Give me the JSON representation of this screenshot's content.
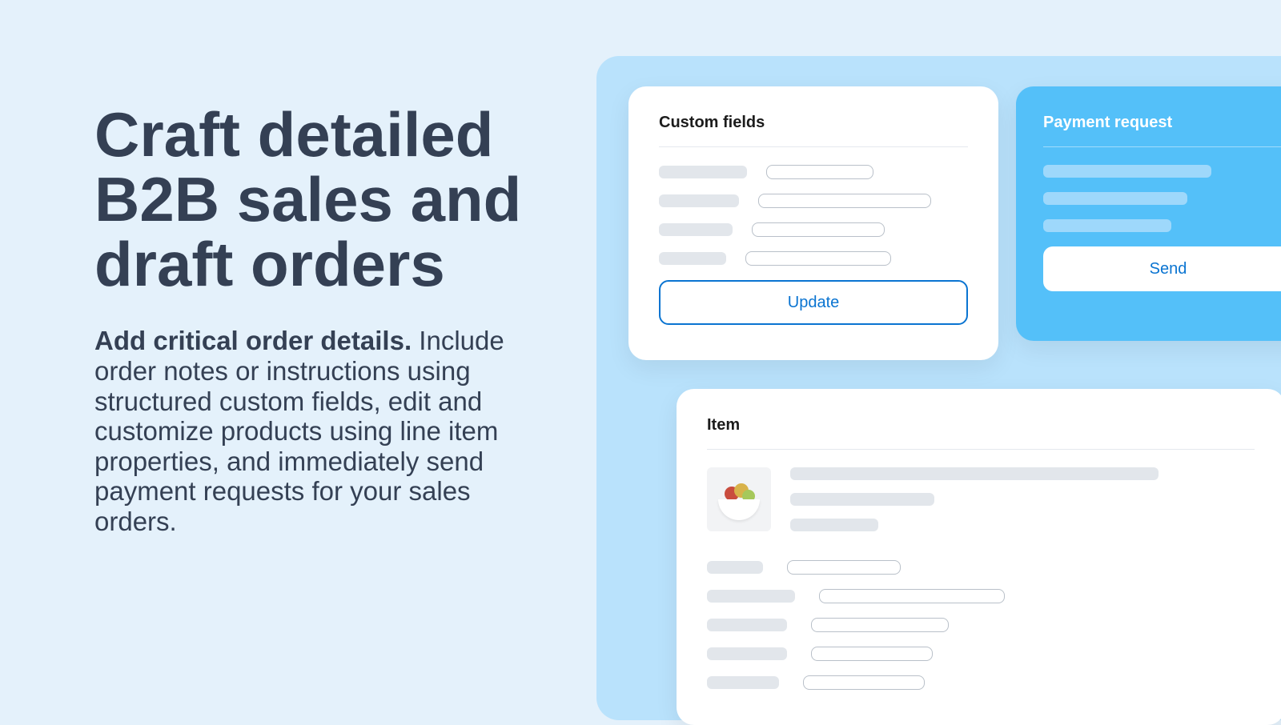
{
  "copy": {
    "headline": "Craft detailed B2B sales and draft orders",
    "lede_bold": "Add critical order details.",
    "lede_rest": " Include order notes or instructions using structured custom fields, edit and customize products using line item properties, and immediately send payment requests for your sales orders."
  },
  "cards": {
    "custom_fields": {
      "title": "Custom fields",
      "button": "Update"
    },
    "payment_request": {
      "title": "Payment request",
      "button": "Send"
    },
    "item": {
      "title": "Item"
    }
  }
}
